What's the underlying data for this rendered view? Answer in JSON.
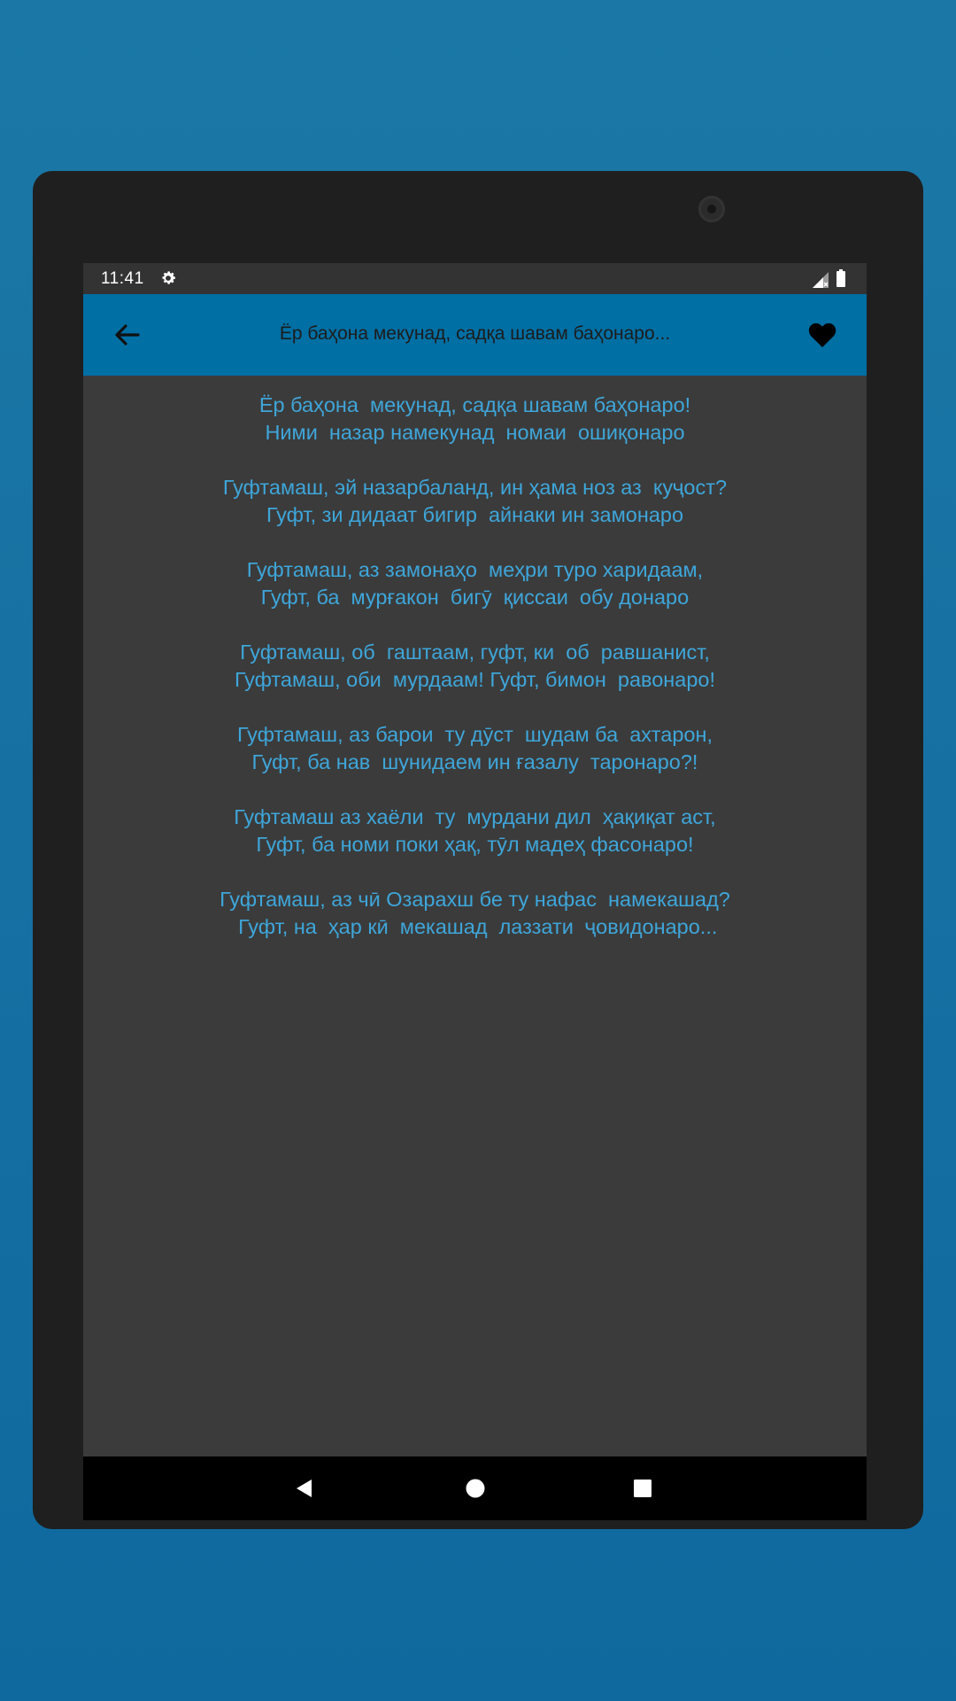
{
  "status_bar": {
    "time": "11:41",
    "icons": [
      "settings-gear-icon",
      "signal-icon",
      "battery-icon"
    ]
  },
  "app_bar": {
    "title": "Ёр баҳона мекунад, садқа шавам баҳонаро...",
    "back_icon": "arrow-back-icon",
    "favorite_icon": "heart-icon"
  },
  "poem": {
    "stanzas": [
      [
        "Ёр баҳона  мекунад, садқа шавам баҳонаро!",
        "Ними  назар намекунад  номаи  ошиқонаро"
      ],
      [
        "Гуфтамаш, эй назарбаланд, ин ҳама ноз аз  куҷост?",
        "Гуфт, зи дидаат бигир  айнаки ин замонаро"
      ],
      [
        "Гуфтамаш, аз замонаҳо  меҳри туро харидаам,",
        "Гуфт, ба  мурғакон  бигӯ  қиссаи  обу донаро"
      ],
      [
        "Гуфтамаш, об  гаштаам, гуфт, ки  об  равшанист,",
        "Гуфтамаш, оби  мурдаам! Гуфт, бимон  равонаро!"
      ],
      [
        "Гуфтамаш, аз барои  ту дӯст  шудам ба  ахтарон,",
        "Гуфт, ба нав  шунидаем ин ғазалу  таронаро?!"
      ],
      [
        "Гуфтамаш аз хаёли  ту  мурдани дил  ҳақиқат аст,",
        "Гуфт, ба номи поки ҳақ, тӯл мадеҳ фасонаро!"
      ],
      [
        "Гуфтамаш, аз чӣ Озарахш бе ту нафас  намекашад?",
        " Гуфт, на  ҳар кӣ  мекашад  лаззати  ҷовидонаро..."
      ]
    ]
  },
  "nav_bar": {
    "icons": [
      "nav-back-triangle-icon",
      "nav-home-circle-icon",
      "nav-recents-square-icon"
    ]
  },
  "colors": {
    "background": "#1670a2",
    "app_bar": "#006fa4",
    "content_bg": "#3b3b3b",
    "poem_text": "#3ea6da"
  }
}
